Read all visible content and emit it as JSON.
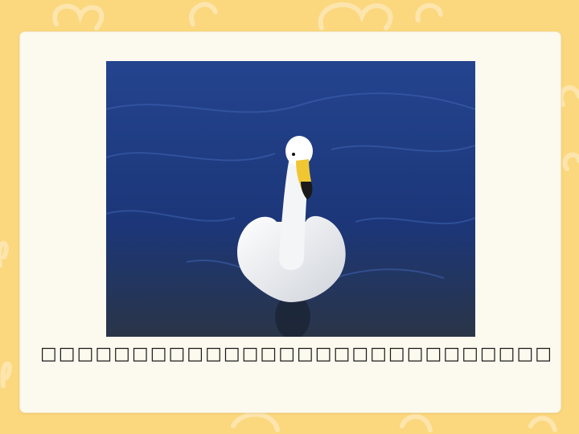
{
  "slide": {
    "caption": "□□□□□□□□□□□□□□□□□□□□□□□□□□□□",
    "background_color": "#fbd77e",
    "card_color": "#fcfaee"
  },
  "photo": {
    "subject": "white swan swimming on blue water",
    "water_color": "#1f3b83"
  }
}
